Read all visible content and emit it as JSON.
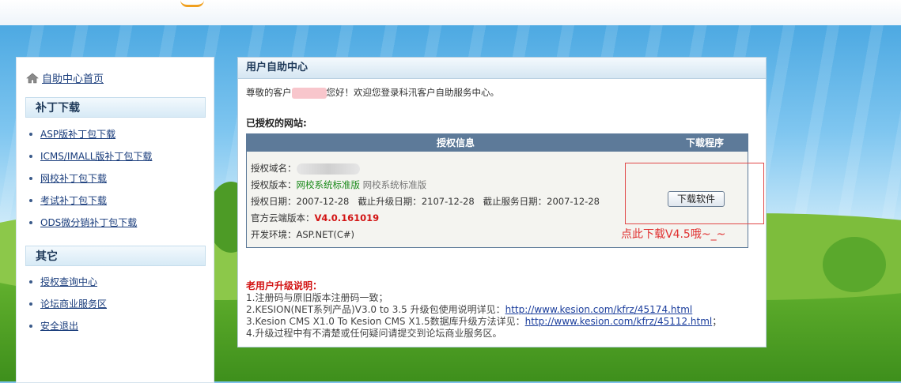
{
  "sidebar": {
    "home_label": "自助中心首页",
    "patch_heading": "补丁下载",
    "patch_items": [
      "ASP版补丁包下载",
      "ICMS/IMALL版补丁包下载",
      "网校补丁包下载",
      "考试补丁包下载",
      "ODS微分销补丁包下载"
    ],
    "other_heading": "其它",
    "other_items": [
      "授权查询中心",
      "论坛商业服务区",
      "安全退出"
    ]
  },
  "main": {
    "title": "用户自助中心",
    "greeting_prefix": "尊敬的客户",
    "greeting_suffix": "您好！欢迎您登录科汛客户自助服务中心。",
    "authorized_label": "已授权的网站:",
    "table": {
      "col_info": "授权信息",
      "col_download": "下载程序",
      "domain_label": "授权域名：",
      "version_label": "授权版本：",
      "version_value": "网校系统标准版",
      "version_value_grey": "网校系统标准版",
      "auth_date_label": "授权日期：",
      "auth_date": "2007-12-28",
      "upgrade_label": "截止升级日期：",
      "upgrade_date": "2107-12-28",
      "service_label": "截止服务日期：",
      "service_date": "2007-12-28",
      "cloud_label": "官方云端版本：",
      "cloud_version": "V4.0.161019",
      "env_label": "开发环境：",
      "env_value": "ASP.NET(C#)",
      "download_button": "下载软件"
    },
    "annotation": "点此下载V4.5哦~_~",
    "notes": {
      "title": "老用户升级说明：",
      "line1": "1.注册码与原旧版本注册码一致；",
      "line2_text": "2.KESION(NET系列产品)V3.0 to 3.5 升级包使用说明详见：",
      "line2_link": "http://www.kesion.com/kfrz/45174.html",
      "line3_text": "3.Kesion CMS X1.0 To Kesion CMS X1.5数据库升级方法详见：",
      "line3_link": "http://www.kesion.com/kfrz/45112.html",
      "line3_suffix": "；",
      "line4": "4.升级过程中有不清楚或任何疑问请提交到论坛商业服务区。"
    }
  },
  "colors": {
    "table_header": "#5d7a99",
    "link": "#1a3d7c",
    "highlight_red": "#d21414",
    "version_green": "#1a8a1a"
  }
}
